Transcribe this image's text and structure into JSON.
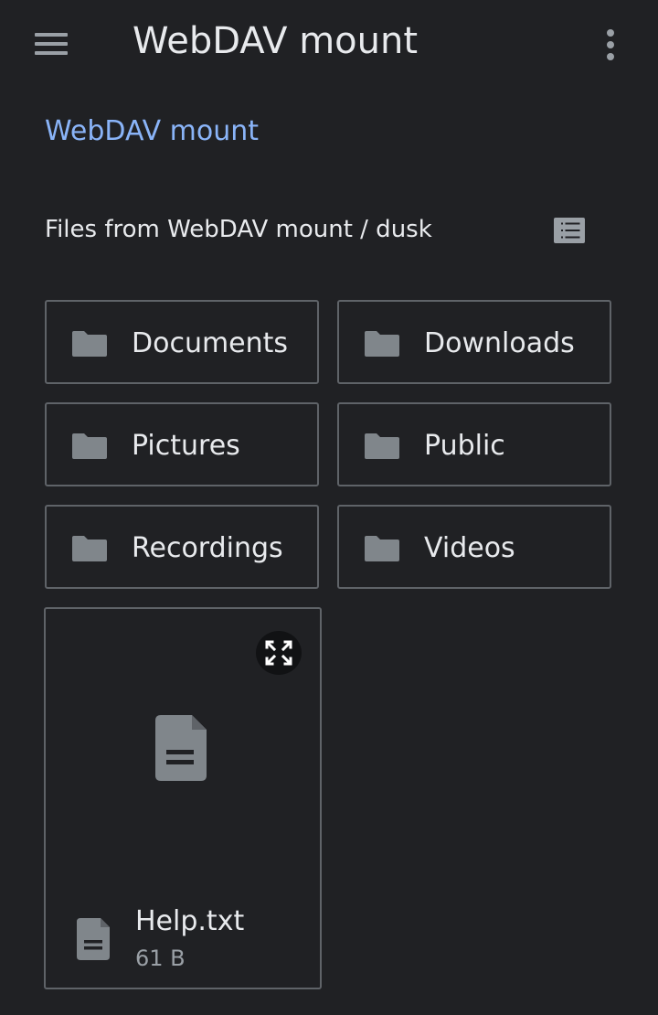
{
  "header": {
    "title": "WebDAV mount",
    "menu_icon": "hamburger-menu-icon",
    "more_icon": "more-vert-icon"
  },
  "breadcrumb": {
    "label": "WebDAV mount"
  },
  "section": {
    "label": "Files from WebDAV mount / dusk",
    "view_toggle_icon": "list-view-icon"
  },
  "folders": [
    {
      "name": "Documents"
    },
    {
      "name": "Downloads"
    },
    {
      "name": "Pictures"
    },
    {
      "name": "Public"
    },
    {
      "name": "Recordings"
    },
    {
      "name": "Videos"
    }
  ],
  "files": [
    {
      "name": "Help.txt",
      "size": "61 B",
      "icon": "text-document-icon"
    }
  ],
  "colors": {
    "background": "#202124",
    "text": "#e8eaed",
    "link": "#8ab4f8",
    "icon": "#9aa0a6",
    "border": "#5f6368"
  }
}
